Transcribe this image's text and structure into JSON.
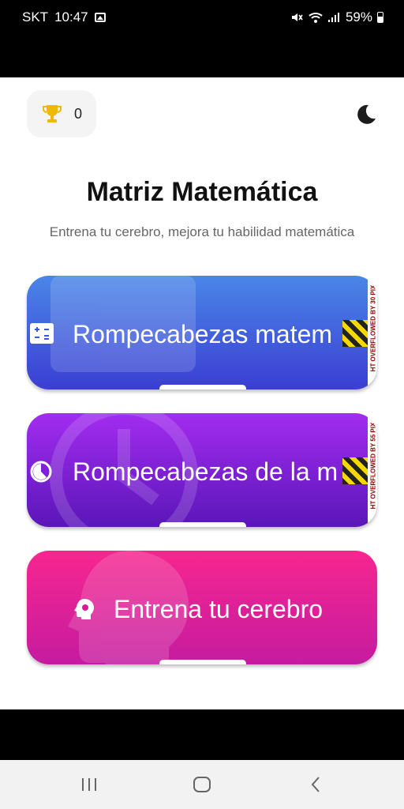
{
  "status_bar": {
    "carrier": "SKT",
    "time": "10:47",
    "battery": "59%"
  },
  "header": {
    "trophy_count": "0"
  },
  "main": {
    "title": "Matriz Matemática",
    "subtitle": "Entrena tu cerebro, mejora tu habilidad matemática",
    "cards": [
      {
        "label": "Rompecabezas matem",
        "overflow_notice": "HT OVERFLOWED BY 30 PIX"
      },
      {
        "label": "Rompecabezas de la m",
        "overflow_notice": "HT OVERFLOWED BY 55 PIX"
      },
      {
        "label": "Entrena tu cerebro"
      }
    ]
  },
  "colors": {
    "card1": "#4a86e8",
    "card2": "#a32cf0",
    "card3": "#f7268f",
    "trophy": "#f0b800"
  }
}
